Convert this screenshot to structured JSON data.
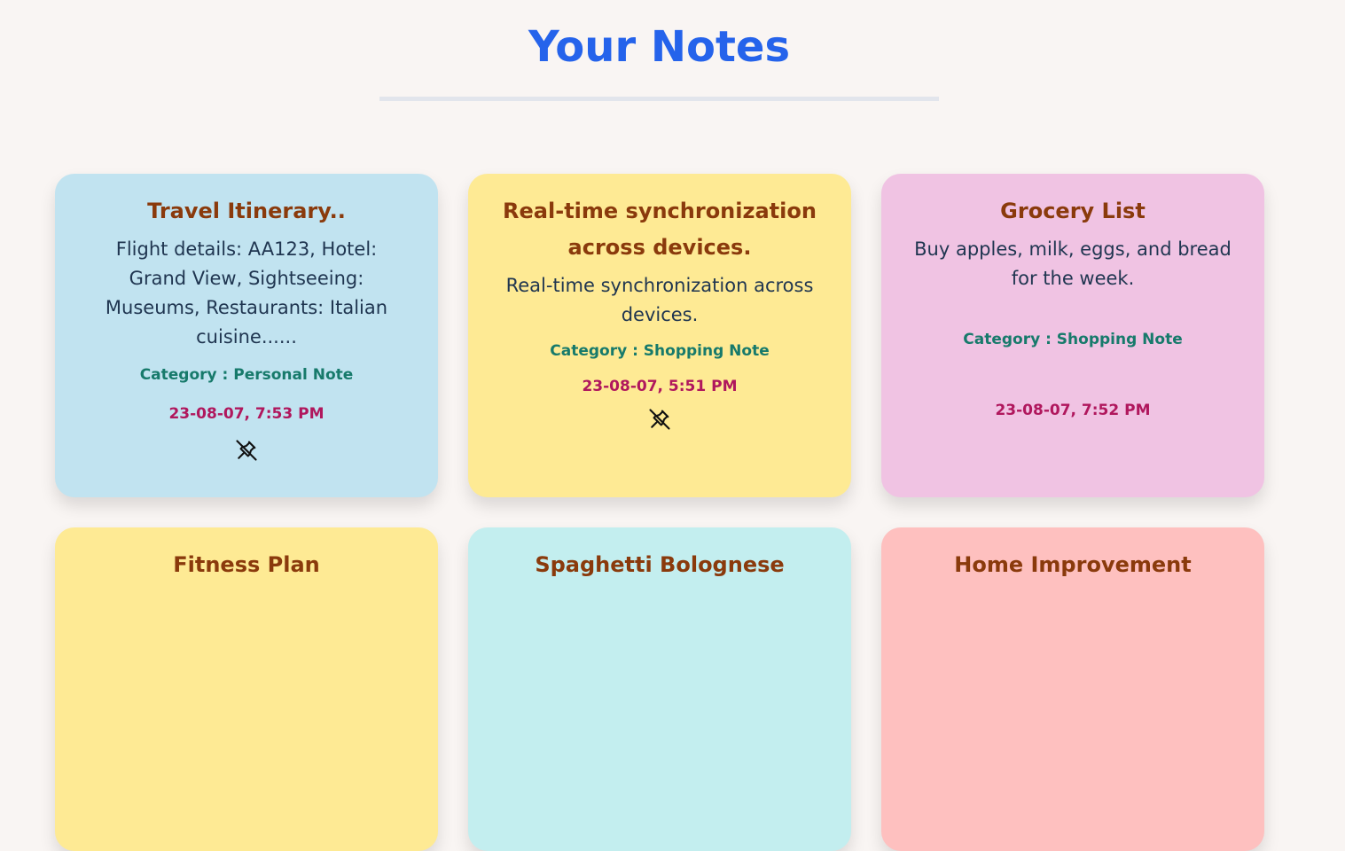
{
  "page": {
    "title": "Your Notes"
  },
  "notes": [
    {
      "title": "Travel Itinerary..",
      "body": "Flight details: AA123, Hotel: Grand View, Sightseeing: Museums, Restaurants: Italian cuisine......",
      "category": "Category : Personal Note",
      "date": "23-08-07, 7:53 PM",
      "color": "#c1e3f0",
      "pinned": true
    },
    {
      "title": "Real-time synchronization across devices.",
      "body": "Real-time synchronization across devices.",
      "category": "Category : Shopping Note",
      "date": "23-08-07, 5:51 PM",
      "color": "#feea94",
      "pinned": true
    },
    {
      "title": "Grocery List",
      "body": "Buy apples, milk, eggs, and bread for the week.",
      "category": "Category : Shopping Note",
      "date": "23-08-07, 7:52 PM",
      "color": "#f0c3e3",
      "pinned": false
    },
    {
      "title": "Fitness Plan",
      "color": "#feea94"
    },
    {
      "title": "Spaghetti Bolognese",
      "color": "#c3eeef"
    },
    {
      "title": "Home Improvement",
      "color": "#fec0bf"
    }
  ],
  "colors": {
    "page_background": "#f9f5f3",
    "title": "#2563eb",
    "card_title": "#8a3a0c",
    "card_body": "#1f3550",
    "category": "#177a6b",
    "date": "#b0175d"
  },
  "icons": {
    "pin": "pin-off-icon"
  }
}
